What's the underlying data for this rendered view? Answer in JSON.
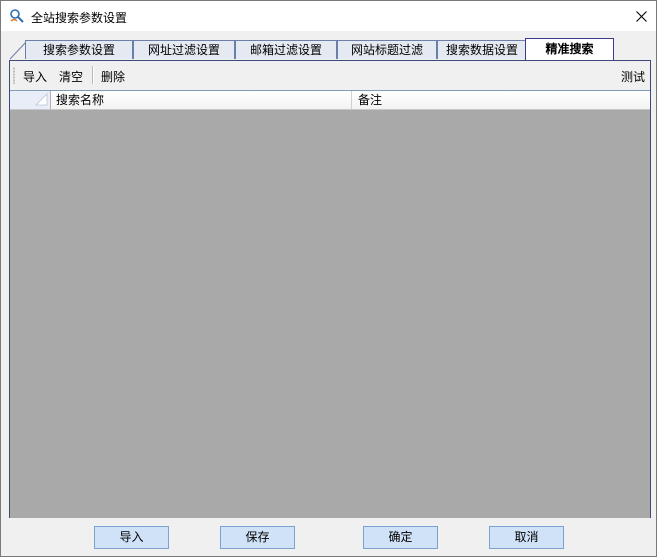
{
  "window": {
    "title": "全站搜索参数设置"
  },
  "tabs": [
    {
      "label": "搜索参数设置",
      "active": false
    },
    {
      "label": "网址过滤设置",
      "active": false
    },
    {
      "label": "邮箱过滤设置",
      "active": false
    },
    {
      "label": "网站标题过滤",
      "active": false
    },
    {
      "label": "搜索数据设置",
      "active": false
    },
    {
      "label": "精准搜索",
      "active": true
    }
  ],
  "toolbar": {
    "import_label": "导入",
    "clear_label": "清空",
    "delete_label": "删除",
    "test_label": "测试"
  },
  "grid": {
    "columns": [
      "搜索名称",
      "备注"
    ],
    "rows": []
  },
  "buttons": {
    "import": "导入",
    "save": "保存",
    "ok": "确定",
    "cancel": "取消"
  },
  "colors": {
    "grid_background": "#a9a9a9",
    "button_face": "#cfe2f7",
    "active_tab_border": "#3b3b8f"
  }
}
